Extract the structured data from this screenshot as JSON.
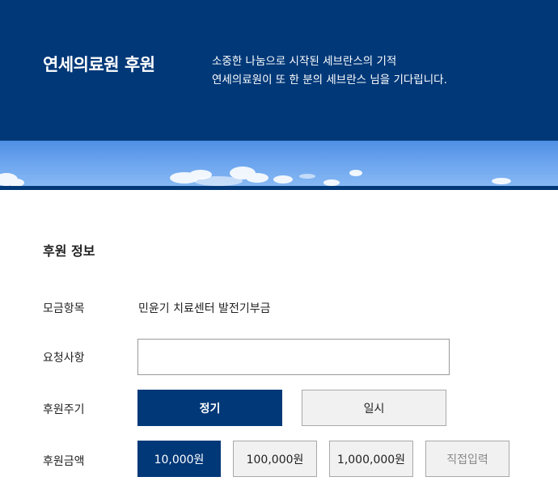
{
  "header": {
    "title": "연세의료원 후원",
    "desc_line1": "소중한 나눔으로 시작된 세브란스의 기적",
    "desc_line2": "연세의료원이 또 한 분의 세브란스 님을 기다립니다."
  },
  "section": {
    "title": "후원 정보"
  },
  "form": {
    "fund_label": "모금항목",
    "fund_value": "민윤기 치료센터 발전기부금",
    "request_label": "요청사항",
    "request_value": "",
    "period_label": "후원주기",
    "period_options": [
      {
        "label": "정기",
        "selected": true
      },
      {
        "label": "일시",
        "selected": false
      }
    ],
    "amount_label": "후원금액",
    "amount_options": [
      {
        "label": "10,000원",
        "selected": true
      },
      {
        "label": "100,000원",
        "selected": false
      },
      {
        "label": "1,000,000원",
        "selected": false
      },
      {
        "label": "직접입력",
        "selected": false
      }
    ]
  },
  "colors": {
    "brand_navy": "#003878",
    "button_off_bg": "#f1f1f1",
    "button_border": "#a8a8a8"
  }
}
